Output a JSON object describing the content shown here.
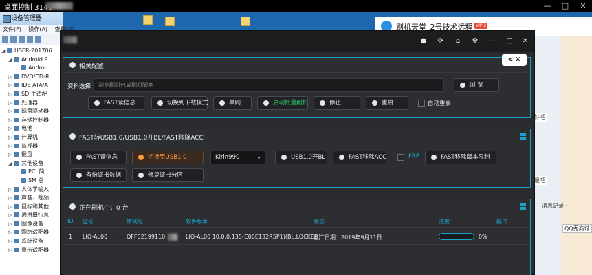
{
  "remote_desktop": {
    "title": "桌面控制 3141",
    "controls": [
      "—",
      "□",
      "✕"
    ]
  },
  "device_manager": {
    "title": "设备管理器",
    "menu": [
      "文件(F)",
      "操作(A)",
      "查看(V)",
      "帮助(H)"
    ],
    "tree": [
      {
        "label": "USER-201706",
        "indent": 0,
        "arrow": "◢"
      },
      {
        "label": "Android P",
        "indent": 1,
        "arrow": "◢"
      },
      {
        "label": "Androi",
        "indent": 2,
        "arrow": ""
      },
      {
        "label": "DVD/CD-R",
        "indent": 1,
        "arrow": "▷"
      },
      {
        "label": "IDE ATA/A",
        "indent": 1,
        "arrow": "▷"
      },
      {
        "label": "SD 主适配",
        "indent": 1,
        "arrow": "▷"
      },
      {
        "label": "处理器",
        "indent": 1,
        "arrow": "▷"
      },
      {
        "label": "磁盘驱动器",
        "indent": 1,
        "arrow": "▷"
      },
      {
        "label": "存储控制器",
        "indent": 1,
        "arrow": "▷"
      },
      {
        "label": "电池",
        "indent": 1,
        "arrow": "▷"
      },
      {
        "label": "计算机",
        "indent": 1,
        "arrow": "▷"
      },
      {
        "label": "监视器",
        "indent": 1,
        "arrow": "▷"
      },
      {
        "label": "键盘",
        "indent": 1,
        "arrow": "▷"
      },
      {
        "label": "其他设备",
        "indent": 1,
        "arrow": "◢"
      },
      {
        "label": "PCI 简",
        "indent": 2,
        "arrow": ""
      },
      {
        "label": "SM 总",
        "indent": 2,
        "arrow": ""
      },
      {
        "label": "人体学输入",
        "indent": 1,
        "arrow": "▷"
      },
      {
        "label": "声音、视频",
        "indent": 1,
        "arrow": "▷"
      },
      {
        "label": "鼠标和其他",
        "indent": 1,
        "arrow": "▷"
      },
      {
        "label": "通用串行总",
        "indent": 1,
        "arrow": "▷"
      },
      {
        "label": "图像设备",
        "indent": 1,
        "arrow": "▷"
      },
      {
        "label": "网络适配器",
        "indent": 1,
        "arrow": "▷"
      },
      {
        "label": "系统设备",
        "indent": 1,
        "arrow": "▷"
      },
      {
        "label": "显示适配器",
        "indent": 1,
        "arrow": "▷"
      }
    ]
  },
  "qq": {
    "title": "刷机天堂_2号技术远程",
    "vip": "VIP 2",
    "bubble1": "好吧",
    "bubble2": "量吧",
    "msg_log": "消息记录 ·",
    "show": "QQ秀商城"
  },
  "tool": {
    "close_pill": "< ✕",
    "title_icons": [
      "●",
      "⟳",
      "⌂",
      "⚙",
      "—",
      "□",
      "✕"
    ],
    "panel1": {
      "title": "相关配置",
      "file_label": "资料选择",
      "file_placeholder": "浏览刷机包或刷机脚本",
      "browse": "浏 览",
      "buttons": [
        "FAST读信息",
        "切换到下载模式",
        "单刷",
        "启动批量刷机",
        "停止",
        "重启"
      ],
      "auto_restart": "自动重启"
    },
    "panel2": {
      "title": "FAST转USB1.0/USB1.0开BL/FAST移除ACC",
      "buttons_row1": [
        "FAST读信息",
        "切换至USB1.0"
      ],
      "chip_select": "Kirin990",
      "buttons_row1b": [
        "USB1.0开BL",
        "FAST移除ACC"
      ],
      "frp": "FRP",
      "remove_limit": "FAST移除版本限制",
      "buttons_row2": [
        "备份证书数据",
        "修复证书分区"
      ]
    },
    "panel3": {
      "title": "正在刷机中：0 台",
      "columns": [
        "ID",
        "型号",
        "序列号",
        "软件版本",
        "状态",
        "进度",
        "操作"
      ],
      "rows": [
        {
          "id": "1",
          "model": "LIO-AL00",
          "serial": "QFF02199110",
          "version": "LIO-AL00 10.0.0.135(C00E132R5P1)(BL:LOCKED)",
          "status": "出厂日期：2019年9月11日",
          "progress": "0%"
        }
      ]
    }
  }
}
